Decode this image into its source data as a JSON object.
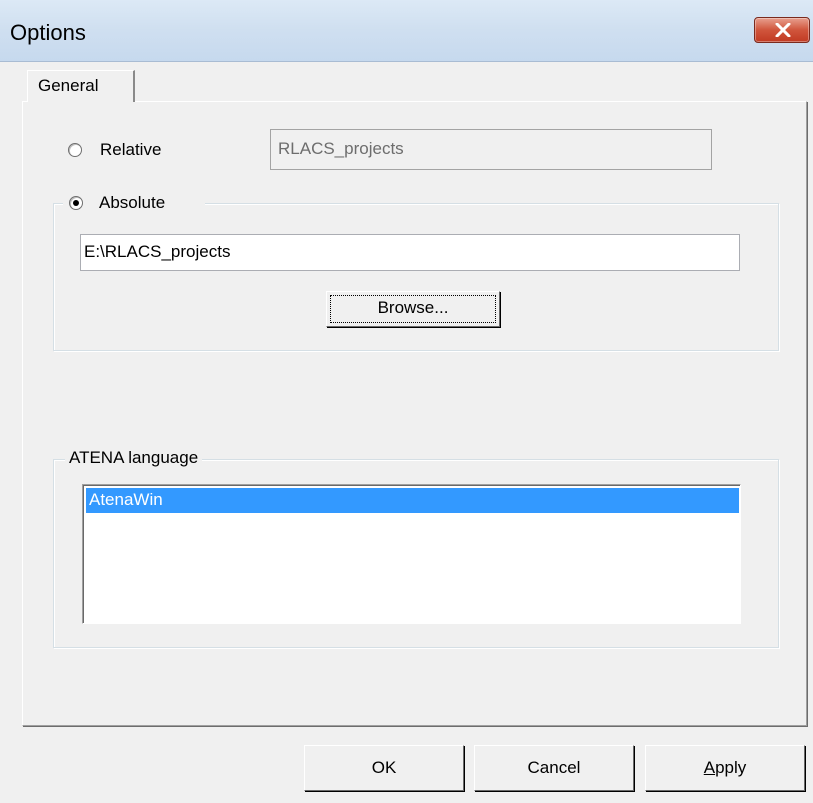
{
  "window": {
    "title": "Options"
  },
  "tabs": [
    {
      "label": "General"
    }
  ],
  "path": {
    "relative": {
      "label": "Relative",
      "value": "RLACS_projects",
      "selected": false
    },
    "absolute": {
      "label": "Absolute",
      "value": "E:\\RLACS_projects",
      "selected": true
    },
    "browse_label": "Browse..."
  },
  "language": {
    "group_label": "ATENA language",
    "items": [
      {
        "label": "AtenaWin",
        "selected": true
      }
    ]
  },
  "buttons": {
    "ok": "OK",
    "cancel": "Cancel",
    "apply": "Apply"
  },
  "colors": {
    "selection": "#3399ff",
    "close_button": "#c13a23",
    "dialog_face": "#f0f0f0"
  },
  "icons": {
    "close": "close-icon"
  }
}
